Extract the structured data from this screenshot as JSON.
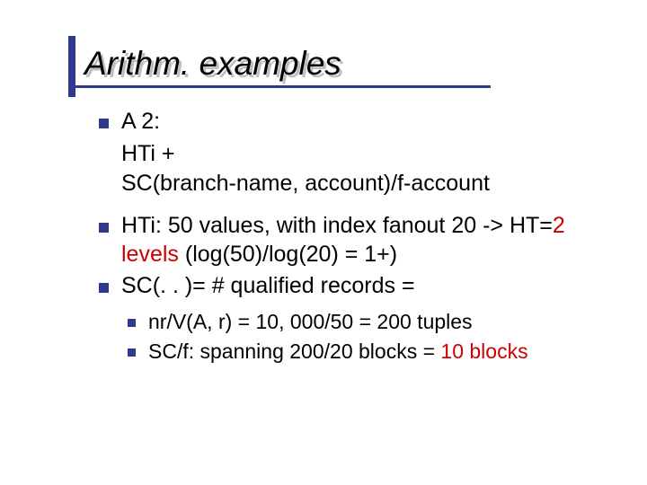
{
  "title": "Arithm. examples",
  "l1_a": "A 2:",
  "l1_a_follow_1": "HTi + ",
  "branch_name_comma_account": "SC(branch-name, account)",
  "l1_a_follow_2b": "/",
  "f_account": "f-account",
  "l1_b_part1": "HTi: 50 values, with index fanout 20 -> HT=",
  "l1_b_num": "2 levels",
  "l1_b_part2": " (log(50)/log(20) = 1+)",
  "l1_c": "SC(. . )= # qualified records =",
  "l2_a_part1": "nr/V(A, r) =  10, 000/50 = 200 tuples",
  "l2_b_part1": "SC/f: spanning 200/20 blocks = ",
  "l2_b_num": "10 blocks"
}
